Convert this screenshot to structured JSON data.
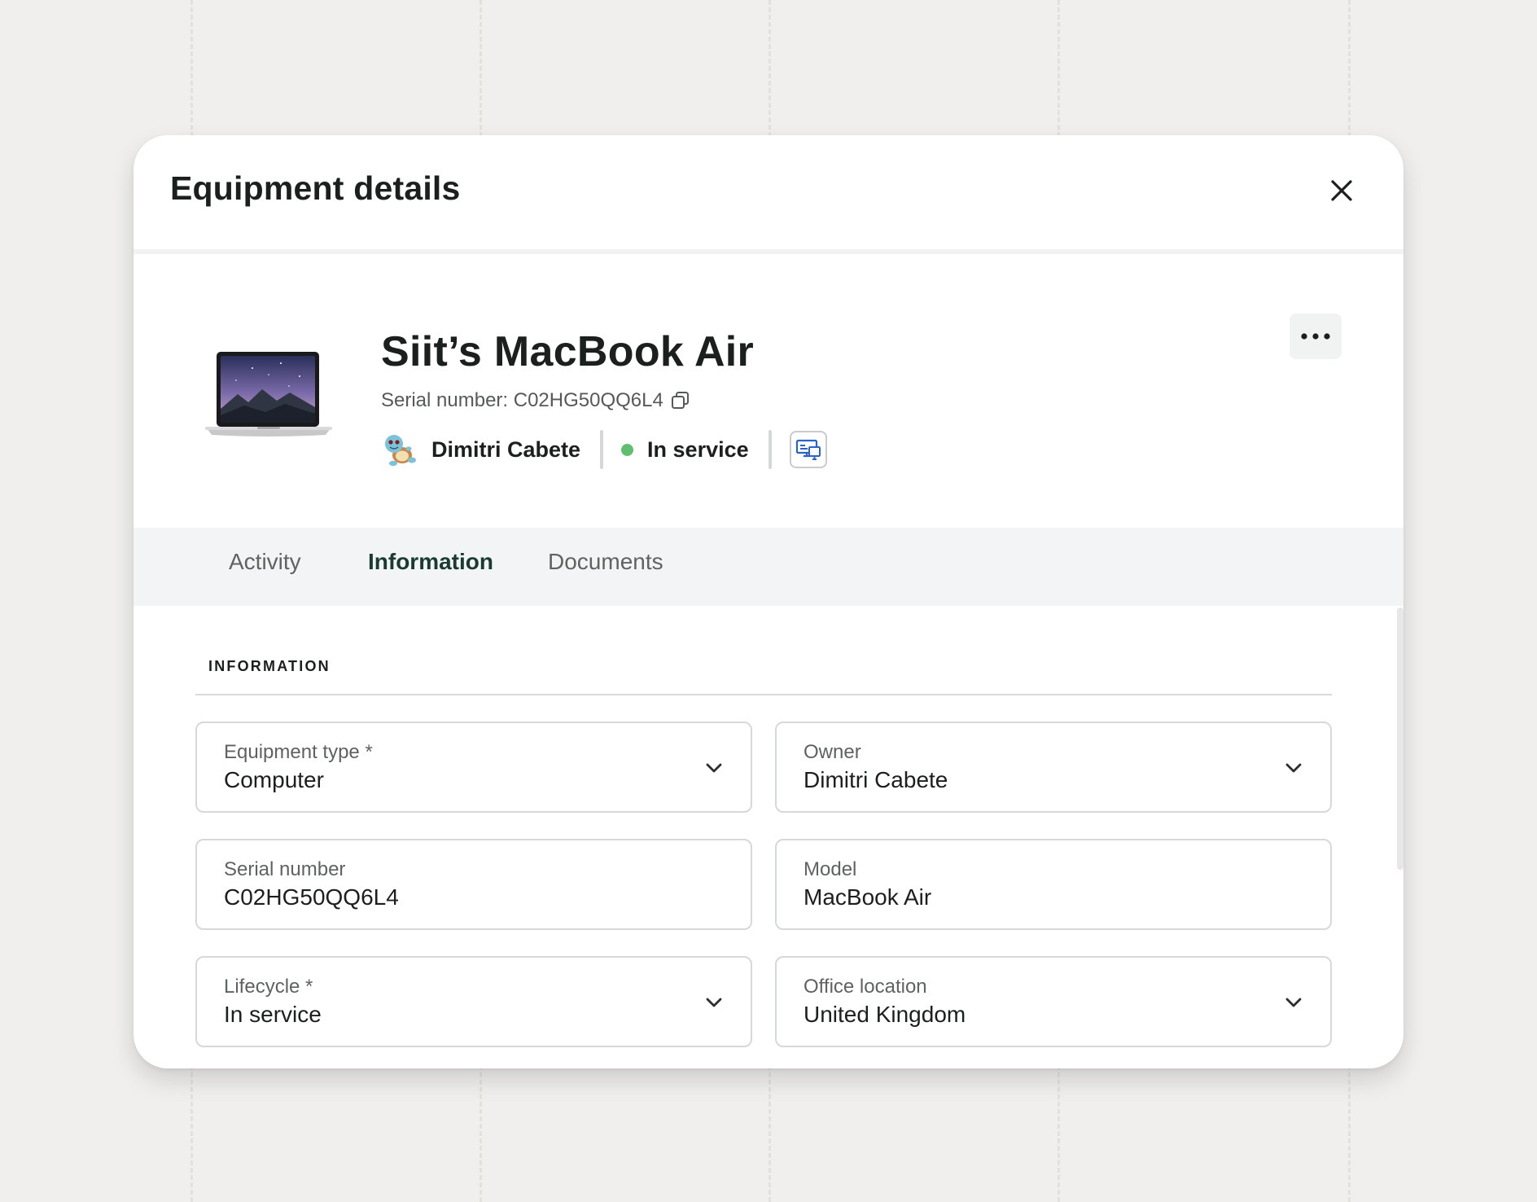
{
  "modal": {
    "title": "Equipment details"
  },
  "asset": {
    "name": "Siit’s MacBook Air",
    "serial_line": "Serial number: C02HG50QQ6L4",
    "owner_name": "Dimitri Cabete",
    "status": "In service",
    "status_color": "#5fbf6e"
  },
  "tabs": [
    {
      "label": "Activity",
      "active": false
    },
    {
      "label": "Information",
      "active": true
    },
    {
      "label": "Documents",
      "active": false
    }
  ],
  "section": {
    "title": "INFORMATION"
  },
  "fields": {
    "equipment_type": {
      "label": "Equipment type *",
      "value": "Computer",
      "type": "select"
    },
    "owner": {
      "label": "Owner",
      "value": "Dimitri Cabete",
      "type": "select"
    },
    "serial_number": {
      "label": "Serial number",
      "value": "C02HG50QQ6L4",
      "type": "text"
    },
    "model": {
      "label": "Model",
      "value": "MacBook Air",
      "type": "text"
    },
    "lifecycle": {
      "label": "Lifecycle *",
      "value": "In service",
      "type": "select"
    },
    "office_location": {
      "label": "Office location",
      "value": "United Kingdom",
      "type": "select"
    }
  },
  "icons": {
    "close": "close-icon",
    "copy": "copy-icon",
    "more": "more-horizontal-icon",
    "device": "remote-desktop-icon",
    "chevron": "chevron-down-icon",
    "avatar": "turtle-avatar",
    "laptop": "laptop-image"
  },
  "colors": {
    "accent_dark": "#1a3a32",
    "device_icon": "#2a63c9"
  }
}
